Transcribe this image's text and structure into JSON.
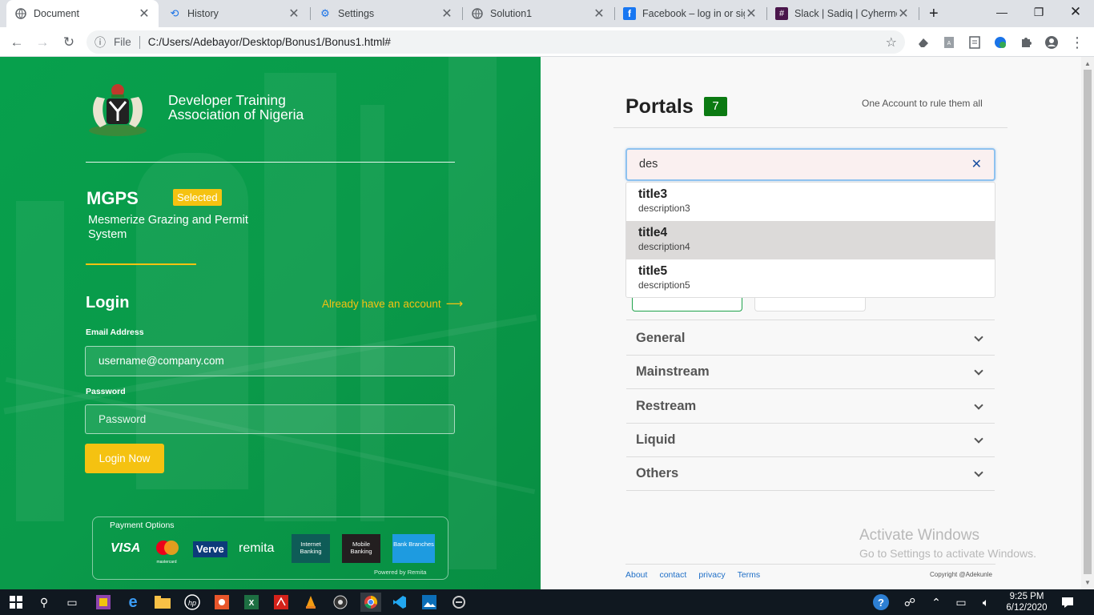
{
  "browser": {
    "tabs": [
      {
        "title": "Document",
        "icon": "globe-icon"
      },
      {
        "title": "History",
        "icon": "history-icon"
      },
      {
        "title": "Settings",
        "icon": "gear-icon"
      },
      {
        "title": "Solution1",
        "icon": "globe-icon"
      },
      {
        "title": "Facebook – log in or sig",
        "icon": "facebook-icon"
      },
      {
        "title": "Slack | Sadiq | Cyherme",
        "icon": "slack-icon"
      }
    ],
    "new_tab": "+",
    "address": {
      "scheme_label": "File",
      "url": "C:/Users/Adebayor/Desktop/Bonus1/Bonus1.html#"
    }
  },
  "left": {
    "org_name_line1": "Developer Training",
    "org_name_line2": "Association of Nigeria",
    "app_code": "MGPS",
    "selected_badge": "Selected",
    "app_name_line1": "Mesmerize Grazing and Permit",
    "app_name_line2": "System",
    "login_heading": "Login",
    "account_link": "Already have an account",
    "email_label": "Email Address",
    "email_value": "username@company.com",
    "password_label": "Password",
    "password_placeholder": "Password",
    "login_button": "Login Now",
    "payment": {
      "heading": "Payment Options",
      "visa": "VISA",
      "mastercard": "mastercard",
      "verve": "Verve",
      "remita": "remita",
      "internet_banking": "Internet Banking",
      "mobile_banking": "Mobile Banking",
      "bank_branches": "Bank Branches",
      "powered_by": "Powered by Remita"
    }
  },
  "right": {
    "title": "Portals",
    "count": "7",
    "tagline": "One Account to rule them all",
    "search_value": "des",
    "results": [
      {
        "title": "title3",
        "description": "description3"
      },
      {
        "title": "title4",
        "description": "description4"
      },
      {
        "title": "title5",
        "description": "description5"
      }
    ],
    "sections": [
      "General",
      "Mainstream",
      "Restream",
      "Liquid",
      "Others"
    ],
    "watermark_line1": "Activate Windows",
    "watermark_line2": "Go to Settings to activate Windows.",
    "footer_links": [
      "About",
      "contact",
      "privacy",
      "Terms"
    ],
    "copyright": "Copyright @Adekunle"
  },
  "taskbar": {
    "time": "9:25 PM",
    "date": "6/12/2020"
  },
  "colors": {
    "green": "#0a9a4a",
    "yellow": "#f5c211",
    "badge_green": "#0b7a12",
    "search_highlight": "#dcdad9"
  }
}
